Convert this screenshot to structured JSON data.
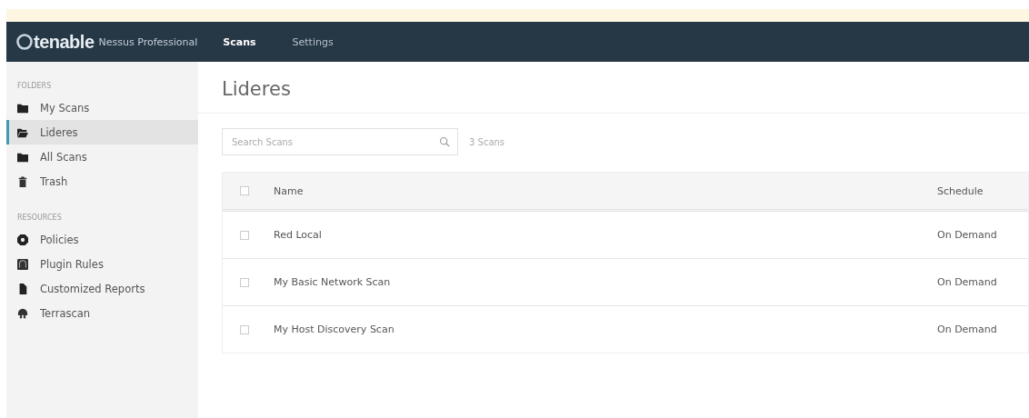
{
  "navbar": {
    "brand": "tenable",
    "product": "Nessus Professional",
    "tabs": [
      {
        "label": "Scans",
        "selected": true
      },
      {
        "label": "Settings",
        "selected": false
      }
    ]
  },
  "sidebar": {
    "sections": [
      {
        "heading": "FOLDERS",
        "items": [
          {
            "label": "My Scans",
            "kind": "folder",
            "selected": false
          },
          {
            "label": "Lideres",
            "kind": "folder-open",
            "selected": true
          },
          {
            "label": "All Scans",
            "kind": "folder",
            "selected": false
          },
          {
            "label": "Trash",
            "kind": "trash",
            "selected": false
          }
        ]
      },
      {
        "heading": "RESOURCES",
        "items": [
          {
            "label": "Policies",
            "kind": "policy",
            "selected": false
          },
          {
            "label": "Plugin Rules",
            "kind": "rules",
            "selected": false
          },
          {
            "label": "Customized Reports",
            "kind": "report",
            "selected": false
          },
          {
            "label": "Terrascan",
            "kind": "scanner",
            "selected": false
          }
        ]
      }
    ]
  },
  "page_title": "Lideres",
  "search": {
    "placeholder": "Search Scans"
  },
  "scan_count": "3 Scans",
  "table": {
    "columns": [
      "Name",
      "Schedule"
    ],
    "header_checked": false,
    "rows": [
      {
        "name": "Red Local",
        "schedule": "On Demand",
        "checked": false
      },
      {
        "name": "My Basic Network Scan",
        "schedule": "On Demand",
        "checked": false
      },
      {
        "name": "My Host Discovery Scan",
        "schedule": "On Demand",
        "checked": false
      }
    ]
  }
}
